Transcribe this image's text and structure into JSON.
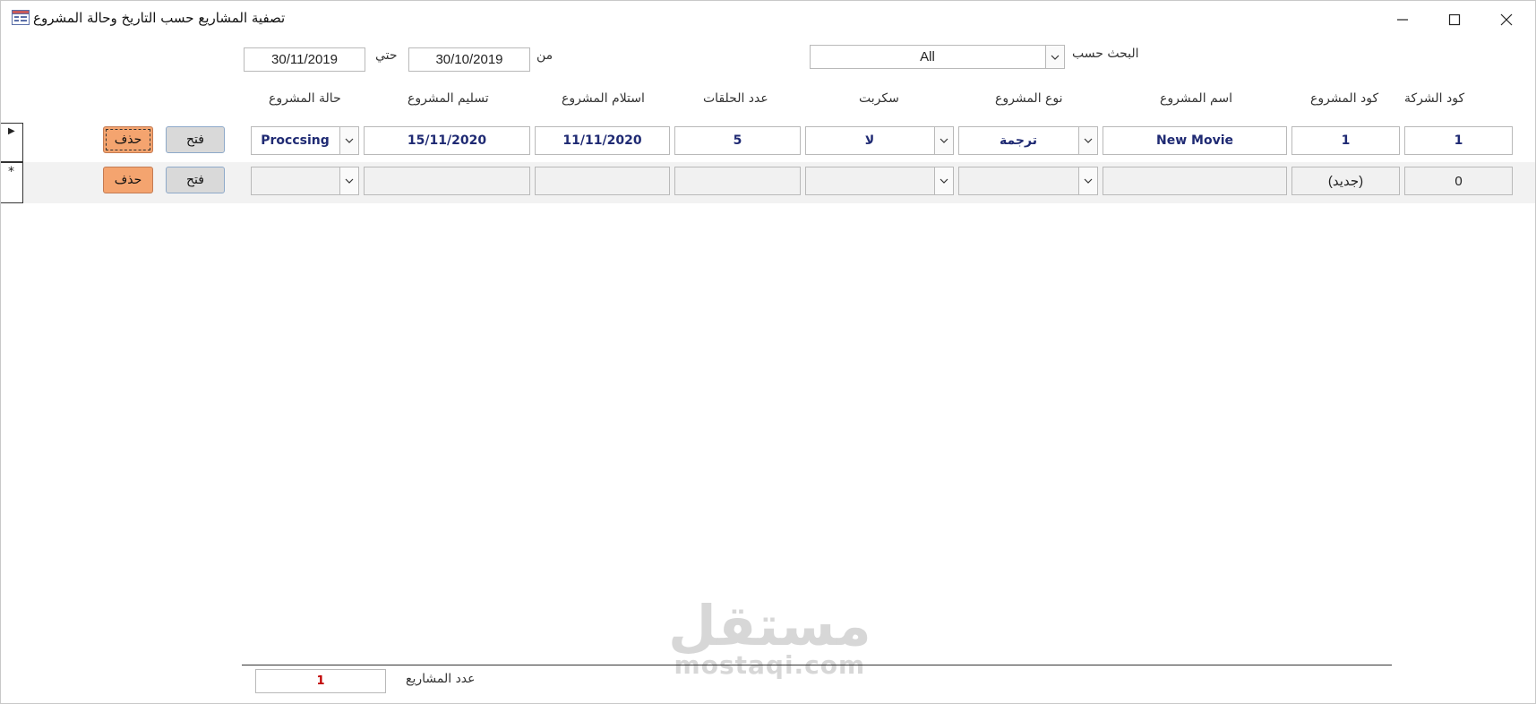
{
  "window": {
    "title": "تصفية المشاريع حسب التاريخ وحالة المشروع",
    "icons": {
      "app": "form-icon",
      "minimize": "minimize-icon",
      "maximize": "maximize-icon",
      "close": "close-icon"
    }
  },
  "filter": {
    "search_by_label": "البحث حسب",
    "search_by_value": "All",
    "from_label": "من",
    "from_value": "30/10/2019",
    "to_label": "حتي",
    "to_value": "30/11/2019"
  },
  "columns": {
    "company_code": "كود الشركة",
    "project_code": "كود المشروع",
    "project_name": "اسم المشروع",
    "project_type": "نوع المشروع",
    "script": "سكربت",
    "episodes": "عدد الحلقات",
    "received": "استلام المشروع",
    "delivery": "تسليم المشروع",
    "status": "حالة المشروع"
  },
  "rows": [
    {
      "company_code": "1",
      "project_code": "1",
      "project_name": "New Movie",
      "project_type": "ترجمة",
      "script": "لا",
      "episodes": "5",
      "received": "11/11/2020",
      "delivery": "15/11/2020",
      "status": "Proccsing",
      "open_label": "فتح",
      "delete_label": "حذف"
    },
    {
      "company_code": "0",
      "project_code": "(جديد)",
      "project_name": "",
      "project_type": "",
      "script": "",
      "episodes": "",
      "received": "",
      "delivery": "",
      "status": "",
      "open_label": "فتح",
      "delete_label": "حذف"
    }
  ],
  "record_selectors": {
    "current": "▶",
    "new": "*"
  },
  "footer": {
    "count_label": "عدد المشاريع",
    "count_value": "1"
  },
  "watermark": {
    "arabic": "مستقل",
    "latin": "mostaqi.com"
  },
  "colors": {
    "delete_button": "#f4a46f",
    "open_button": "#d9d9d9",
    "data_text": "#1f2a73",
    "count_text": "#c00000"
  }
}
